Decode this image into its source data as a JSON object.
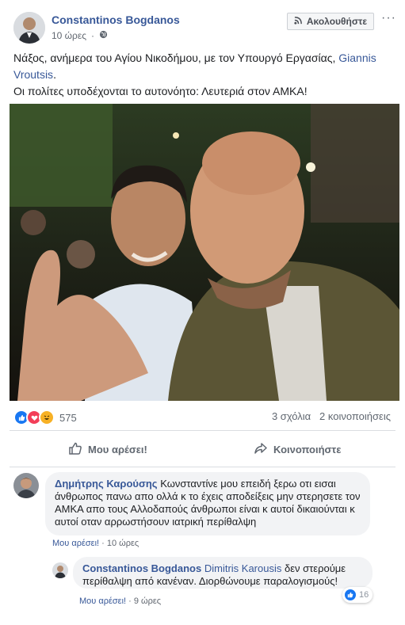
{
  "post": {
    "author": "Constantinos Bogdanos",
    "time": "10 ώρες",
    "follow_label": "Ακολουθήστε",
    "text_line1": "Νάξος, ανήμερα του Αγίου Νικοδήμου, με τον Υπουργό Εργασίας, ",
    "text_link": "Giannis Vroutsis",
    "text_line1_end": ".",
    "text_line2": "Οι πολίτες υποδέχονται το αυτονόητο: Λευτεριά στον ΑΜΚΑ!"
  },
  "reactions": {
    "count": "575",
    "comments": "3 σχόλια",
    "shares": "2 κοινοποιήσεις",
    "types": [
      "like-icon",
      "love-icon",
      "haha-icon"
    ],
    "colors": {
      "like": "#1877f2",
      "love": "#f33e58",
      "haha": "#f7b125"
    }
  },
  "actions": {
    "like_label": "Μου αρέσει!",
    "share_label": "Κοινοποιήστε"
  },
  "comments": [
    {
      "author": "Δημήτρης Καρούσης",
      "text": "Κωνσταντίνε μου επειδή ξερω οτι εισαι άνθρωπος πανω απο ολλά κ το έχεις αποδείξεις μην στερησετε τον ΑΜΚΑ απο τους Αλλοδαπούς άνθρωποι είναι κ αυτοί δικαιούνται κ αυτοί οταν αρρωστήσουν ιατρική περίθαλψη",
      "like_label": "Μου αρέσει!",
      "time": "10 ώρες"
    },
    {
      "author": "Constantinos Bogdanos",
      "tag": "Dimitris Karousis",
      "text": " δεν στερούμε περίθαλψη από κανέναν. Διορθώνουμε παραλογισμούς!",
      "like_label": "Μου αρέσει!",
      "time": "9 ώρες",
      "reaction_count": "16"
    }
  ]
}
